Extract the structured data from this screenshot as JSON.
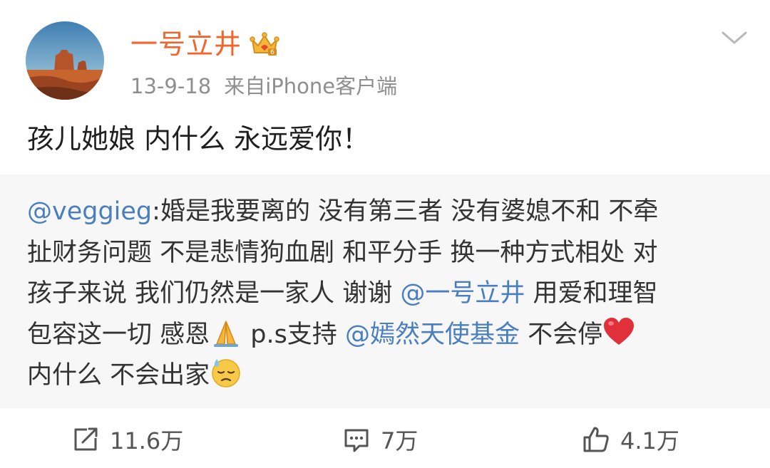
{
  "header": {
    "username": "一号立井",
    "badge_icon": "crown-vip-icon",
    "timestamp": "13-9-18",
    "source": "来自iPhone客户端",
    "menu_icon": "chevron-down-icon"
  },
  "post": {
    "text": "孩儿她娘 内什么 永远爱你！"
  },
  "repost": {
    "lines": [
      [
        {
          "t": "@veggieg",
          "mention": true
        },
        {
          "t": ":婚是我要离的 没有第三者 没有婆媳不和 不牵"
        }
      ],
      [
        {
          "t": "扯财务问题 不是悲情狗血剧 和平分手 换一种方式相处 对"
        }
      ],
      [
        {
          "t": "孩子来说 我们仍然是一家人 谢谢 "
        },
        {
          "t": "@一号立井",
          "mention": true
        },
        {
          "t": "  用爱和理智"
        }
      ],
      [
        {
          "t": "包容这一切 感恩"
        },
        {
          "emoji": "folded-hands-emoji"
        },
        {
          "t": "  p.s支持 "
        },
        {
          "t": "@嫣然天使基金",
          "mention": true
        },
        {
          "t": "  不会停"
        },
        {
          "emoji": "red-heart-emoji"
        }
      ],
      [
        {
          "t": "内什么 不会出家"
        },
        {
          "emoji": "downcast-sweat-emoji"
        }
      ]
    ]
  },
  "actions": {
    "repost_count": "11.6万",
    "comment_count": "7万",
    "like_count": "4.1万"
  },
  "colors": {
    "username": "#f2652c",
    "mention": "#4a7fbf",
    "meta": "#8f8f8f",
    "repost_bg": "#f7f7f7"
  }
}
